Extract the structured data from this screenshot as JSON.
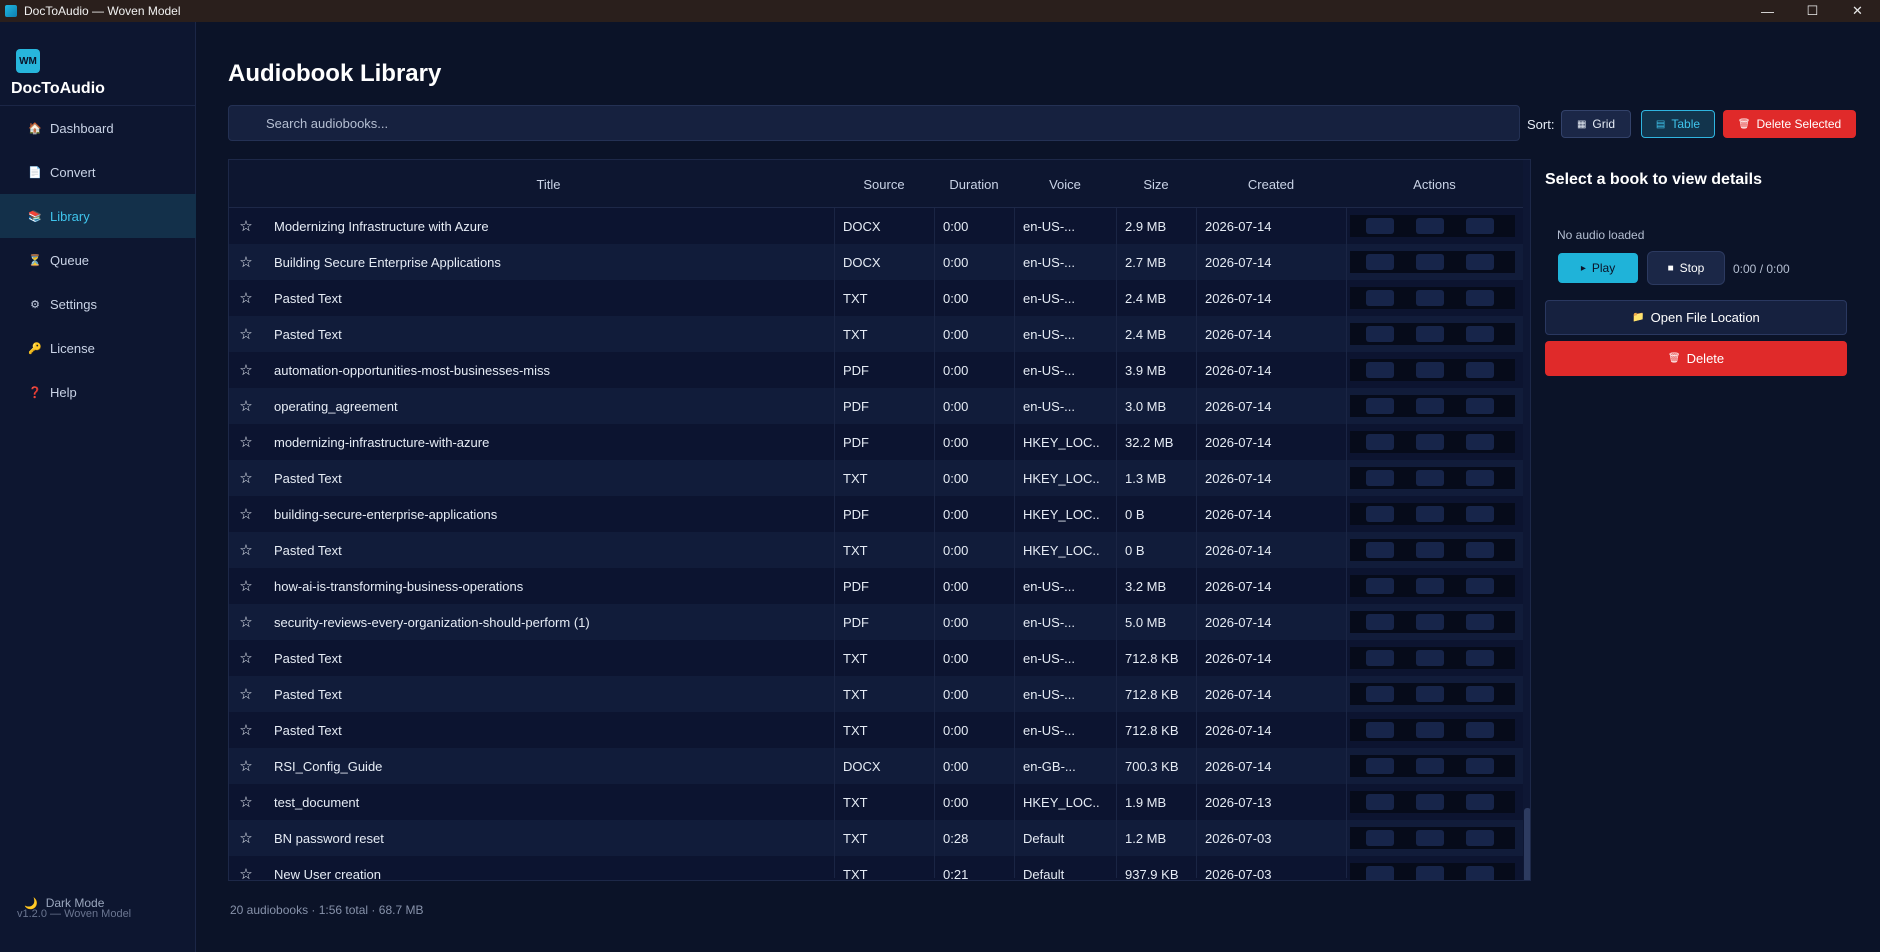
{
  "window": {
    "title": "DocToAudio — Woven Model",
    "controls": {
      "minimize": "—",
      "maximize": "☐",
      "close": "✕"
    }
  },
  "sidebar": {
    "logo_text": "WM",
    "app_name": "DocToAudio",
    "items": [
      {
        "label": "Dashboard",
        "icon": "house-icon",
        "glyph": "🏠"
      },
      {
        "label": "Convert",
        "icon": "document-icon",
        "glyph": "📄"
      },
      {
        "label": "Library",
        "icon": "books-icon",
        "glyph": "📚"
      },
      {
        "label": "Queue",
        "icon": "hourglass-icon",
        "glyph": "⏳"
      },
      {
        "label": "Settings",
        "icon": "gear-icon",
        "glyph": "⚙"
      },
      {
        "label": "License",
        "icon": "key-icon",
        "glyph": "🔑"
      },
      {
        "label": "Help",
        "icon": "question-icon",
        "glyph": "❓"
      }
    ],
    "active_item": "Library",
    "theme_toggle": {
      "label": "Dark Mode",
      "icon": "moon-icon",
      "glyph": "🌙"
    },
    "version": "v1.2.0 — Woven Model"
  },
  "main": {
    "title": "Audiobook Library",
    "search": {
      "placeholder": "Search audiobooks...",
      "value": ""
    },
    "sort_label": "Sort:",
    "view_buttons": {
      "grid": {
        "label": "Grid",
        "icon": "grid-icon",
        "glyph": "▦"
      },
      "table": {
        "label": "Table",
        "icon": "table-icon",
        "glyph": "▤",
        "selected": true
      }
    },
    "delete_selected": {
      "label": "Delete Selected",
      "icon": "trash-icon",
      "glyph": "🗑"
    },
    "table": {
      "columns": [
        "Title",
        "Source",
        "Duration",
        "Voice",
        "Size",
        "Created",
        "Actions"
      ],
      "star_glyph": "☆",
      "rows": [
        {
          "title": "Modernizing Infrastructure with Azure",
          "source": "DOCX",
          "duration": "0:00",
          "voice": "en-US-...",
          "size": "2.9 MB",
          "created": "2026-07-14"
        },
        {
          "title": "Building Secure Enterprise Applications",
          "source": "DOCX",
          "duration": "0:00",
          "voice": "en-US-...",
          "size": "2.7 MB",
          "created": "2026-07-14"
        },
        {
          "title": "Pasted Text",
          "source": "TXT",
          "duration": "0:00",
          "voice": "en-US-...",
          "size": "2.4 MB",
          "created": "2026-07-14"
        },
        {
          "title": "Pasted Text",
          "source": "TXT",
          "duration": "0:00",
          "voice": "en-US-...",
          "size": "2.4 MB",
          "created": "2026-07-14"
        },
        {
          "title": "automation-opportunities-most-businesses-miss",
          "source": "PDF",
          "duration": "0:00",
          "voice": "en-US-...",
          "size": "3.9 MB",
          "created": "2026-07-14"
        },
        {
          "title": "operating_agreement",
          "source": "PDF",
          "duration": "0:00",
          "voice": "en-US-...",
          "size": "3.0 MB",
          "created": "2026-07-14"
        },
        {
          "title": "modernizing-infrastructure-with-azure",
          "source": "PDF",
          "duration": "0:00",
          "voice": "HKEY_LOC...",
          "size": "32.2 MB",
          "created": "2026-07-14"
        },
        {
          "title": "Pasted Text",
          "source": "TXT",
          "duration": "0:00",
          "voice": "HKEY_LOC...",
          "size": "1.3 MB",
          "created": "2026-07-14"
        },
        {
          "title": "building-secure-enterprise-applications",
          "source": "PDF",
          "duration": "0:00",
          "voice": "HKEY_LOC...",
          "size": "0 B",
          "created": "2026-07-14"
        },
        {
          "title": "Pasted Text",
          "source": "TXT",
          "duration": "0:00",
          "voice": "HKEY_LOC...",
          "size": "0 B",
          "created": "2026-07-14"
        },
        {
          "title": "how-ai-is-transforming-business-operations",
          "source": "PDF",
          "duration": "0:00",
          "voice": "en-US-...",
          "size": "3.2 MB",
          "created": "2026-07-14"
        },
        {
          "title": "security-reviews-every-organization-should-perform (1)",
          "source": "PDF",
          "duration": "0:00",
          "voice": "en-US-...",
          "size": "5.0 MB",
          "created": "2026-07-14"
        },
        {
          "title": "Pasted Text",
          "source": "TXT",
          "duration": "0:00",
          "voice": "en-US-...",
          "size": "712.8 KB",
          "created": "2026-07-14"
        },
        {
          "title": "Pasted Text",
          "source": "TXT",
          "duration": "0:00",
          "voice": "en-US-...",
          "size": "712.8 KB",
          "created": "2026-07-14"
        },
        {
          "title": "Pasted Text",
          "source": "TXT",
          "duration": "0:00",
          "voice": "en-US-...",
          "size": "712.8 KB",
          "created": "2026-07-14"
        },
        {
          "title": "RSI_Config_Guide",
          "source": "DOCX",
          "duration": "0:00",
          "voice": "en-GB-...",
          "size": "700.3 KB",
          "created": "2026-07-14"
        },
        {
          "title": "test_document",
          "source": "TXT",
          "duration": "0:00",
          "voice": "HKEY_LOC...",
          "size": "1.9 MB",
          "created": "2026-07-13"
        },
        {
          "title": "BN password reset",
          "source": "TXT",
          "duration": "0:28",
          "voice": "Default",
          "size": "1.2 MB",
          "created": "2026-07-03"
        },
        {
          "title": "New User creation",
          "source": "TXT",
          "duration": "0:21",
          "voice": "Default",
          "size": "937.9 KB",
          "created": "2026-07-03"
        }
      ]
    },
    "footer": "20 audiobooks · 1:56 total · 68.7 MB"
  },
  "details": {
    "title": "Select a book to view details",
    "status": "No audio loaded",
    "play": {
      "label": "Play",
      "glyph": "▸"
    },
    "stop": {
      "label": "Stop",
      "glyph": "■"
    },
    "time": "0:00 / 0:00",
    "open_location": {
      "label": "Open File Location",
      "icon": "folder-icon",
      "glyph": "📁"
    },
    "delete": {
      "label": "Delete",
      "icon": "trash-icon",
      "glyph": "🗑"
    }
  },
  "colors": {
    "background": "#0b1328",
    "sidebar": "#0d1630",
    "accent": "#27b6dc",
    "danger": "#e02a2a",
    "row_alt": "#111c3a"
  }
}
